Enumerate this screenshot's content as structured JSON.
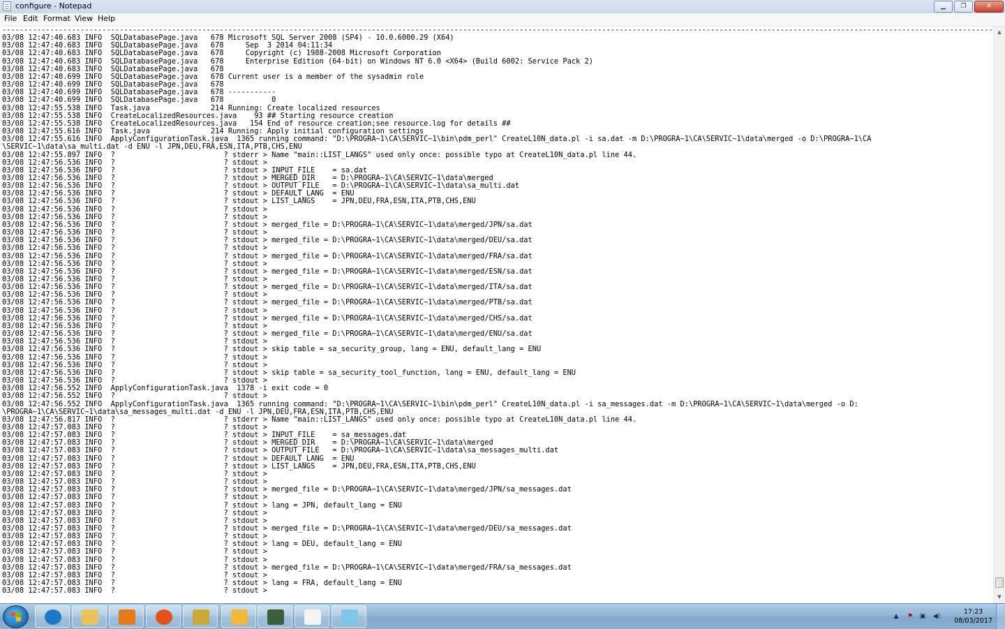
{
  "window": {
    "title": "configure - Notepad"
  },
  "menu": [
    "File",
    "Edit",
    "Format",
    "View",
    "Help"
  ],
  "log_lines": [
    "---------------------------------------------------------------------------------------------------------------------------------------------------------------------------------------------------------------------------------------------------------------",
    "03/08 12:47:40.683 INFO  SQLDatabasePage.java   678 Microsoft SQL Server 2008 (SP4) - 10.0.6000.29 (X64)",
    "03/08 12:47:40.683 INFO  SQLDatabasePage.java   678     Sep  3 2014 04:11:34",
    "03/08 12:47:40.683 INFO  SQLDatabasePage.java   678     Copyright (c) 1988-2008 Microsoft Corporation",
    "03/08 12:47:40.683 INFO  SQLDatabasePage.java   678     Enterprise Edition (64-bit) on Windows NT 6.0 <X64> (Build 6002: Service Pack 2)",
    "03/08 12:47:40.683 INFO  SQLDatabasePage.java   678",
    "03/08 12:47:40.699 INFO  SQLDatabasePage.java   678 Current user is a member of the sysadmin role",
    "03/08 12:47:40.699 INFO  SQLDatabasePage.java   678",
    "03/08 12:47:40.699 INFO  SQLDatabasePage.java   678 -----------",
    "03/08 12:47:40.699 INFO  SQLDatabasePage.java   678           0",
    "03/08 12:47:55.538 INFO  Task.java              214 Running: Create localized resources",
    "03/08 12:47:55.538 INFO  CreateLocalizedResources.java    93 ## Starting resource creation",
    "03/08 12:47:55.538 INFO  CreateLocalizedResources.java   154 End of resource creation;see resource.log for details ##",
    "03/08 12:47:55.616 INFO  Task.java              214 Running: Apply initial configuration settings",
    "03/08 12:47:55.616 INFO  ApplyConfigurationTask.java  1365 running command: \"D:\\PROGRA~1\\CA\\SERVIC~1\\bin\\pdm_perl\" CreateL10N_data.pl -i sa.dat -m D:\\PROGRA~1\\CA\\SERVIC~1\\data\\merged -o D:\\PROGRA~1\\CA",
    "\\SERVIC~1\\data\\sa_multi.dat -d ENU -l JPN,DEU,FRA,ESN,ITA,PTB,CHS,ENU",
    "03/08 12:47:55.897 INFO  ?                         ? stderr > Name \"main::LIST_LANGS\" used only once: possible typo at CreateL10N_data.pl line 44.",
    "03/08 12:47:56.536 INFO  ?                         ? stdout >",
    "03/08 12:47:56.536 INFO  ?                         ? stdout > INPUT_FILE    = sa.dat",
    "03/08 12:47:56.536 INFO  ?                         ? stdout > MERGED_DIR    = D:\\PROGRA~1\\CA\\SERVIC~1\\data\\merged",
    "03/08 12:47:56.536 INFO  ?                         ? stdout > OUTPUT_FILE   = D:\\PROGRA~1\\CA\\SERVIC~1\\data\\sa_multi.dat",
    "03/08 12:47:56.536 INFO  ?                         ? stdout > DEFAULT_LANG  = ENU",
    "03/08 12:47:56.536 INFO  ?                         ? stdout > LIST_LANGS    = JPN,DEU,FRA,ESN,ITA,PTB,CHS,ENU",
    "03/08 12:47:56.536 INFO  ?                         ? stdout >",
    "03/08 12:47:56.536 INFO  ?                         ? stdout >",
    "03/08 12:47:56.536 INFO  ?                         ? stdout > merged_file = D:\\PROGRA~1\\CA\\SERVIC~1\\data\\merged/JPN/sa.dat",
    "03/08 12:47:56.536 INFO  ?                         ? stdout >",
    "03/08 12:47:56.536 INFO  ?                         ? stdout > merged_file = D:\\PROGRA~1\\CA\\SERVIC~1\\data\\merged/DEU/sa.dat",
    "03/08 12:47:56.536 INFO  ?                         ? stdout >",
    "03/08 12:47:56.536 INFO  ?                         ? stdout > merged_file = D:\\PROGRA~1\\CA\\SERVIC~1\\data\\merged/FRA/sa.dat",
    "03/08 12:47:56.536 INFO  ?                         ? stdout >",
    "03/08 12:47:56.536 INFO  ?                         ? stdout > merged_file = D:\\PROGRA~1\\CA\\SERVIC~1\\data\\merged/ESN/sa.dat",
    "03/08 12:47:56.536 INFO  ?                         ? stdout >",
    "03/08 12:47:56.536 INFO  ?                         ? stdout > merged_file = D:\\PROGRA~1\\CA\\SERVIC~1\\data\\merged/ITA/sa.dat",
    "03/08 12:47:56.536 INFO  ?                         ? stdout >",
    "03/08 12:47:56.536 INFO  ?                         ? stdout > merged_file = D:\\PROGRA~1\\CA\\SERVIC~1\\data\\merged/PTB/sa.dat",
    "03/08 12:47:56.536 INFO  ?                         ? stdout >",
    "03/08 12:47:56.536 INFO  ?                         ? stdout > merged_file = D:\\PROGRA~1\\CA\\SERVIC~1\\data\\merged/CHS/sa.dat",
    "03/08 12:47:56.536 INFO  ?                         ? stdout >",
    "03/08 12:47:56.536 INFO  ?                         ? stdout > merged_file = D:\\PROGRA~1\\CA\\SERVIC~1\\data\\merged/ENU/sa.dat",
    "03/08 12:47:56.536 INFO  ?                         ? stdout >",
    "03/08 12:47:56.536 INFO  ?                         ? stdout > skip table = sa_security_group, lang = ENU, default_lang = ENU",
    "03/08 12:47:56.536 INFO  ?                         ? stdout >",
    "03/08 12:47:56.536 INFO  ?                         ? stdout >",
    "03/08 12:47:56.536 INFO  ?                         ? stdout > skip table = sa_security_tool_function, lang = ENU, default_lang = ENU",
    "03/08 12:47:56.536 INFO  ?                         ? stdout >",
    "03/08 12:47:56.552 INFO  ApplyConfigurationTask.java  1378 -i exit code = 0",
    "03/08 12:47:56.552 INFO  ?                         ? stdout >",
    "03/08 12:47:56.552 INFO  ApplyConfigurationTask.java  1365 running command: \"D:\\PROGRA~1\\CA\\SERVIC~1\\bin\\pdm_perl\" CreateL10N_data.pl -i sa_messages.dat -m D:\\PROGRA~1\\CA\\SERVIC~1\\data\\merged -o D:",
    "\\PROGRA~1\\CA\\SERVIC~1\\data\\sa_messages_multi.dat -d ENU -l JPN,DEU,FRA,ESN,ITA,PTB,CHS,ENU",
    "03/08 12:47:56.817 INFO  ?                         ? stderr > Name \"main::LIST_LANGS\" used only once: possible typo at CreateL10N_data.pl line 44.",
    "03/08 12:47:57.083 INFO  ?                         ? stdout >",
    "03/08 12:47:57.083 INFO  ?                         ? stdout > INPUT_FILE    = sa_messages.dat",
    "03/08 12:47:57.083 INFO  ?                         ? stdout > MERGED_DIR    = D:\\PROGRA~1\\CA\\SERVIC~1\\data\\merged",
    "03/08 12:47:57.083 INFO  ?                         ? stdout > OUTPUT_FILE   = D:\\PROGRA~1\\CA\\SERVIC~1\\data\\sa_messages_multi.dat",
    "03/08 12:47:57.083 INFO  ?                         ? stdout > DEFAULT_LANG  = ENU",
    "03/08 12:47:57.083 INFO  ?                         ? stdout > LIST_LANGS    = JPN,DEU,FRA,ESN,ITA,PTB,CHS,ENU",
    "03/08 12:47:57.083 INFO  ?                         ? stdout >",
    "03/08 12:47:57.083 INFO  ?                         ? stdout >",
    "03/08 12:47:57.083 INFO  ?                         ? stdout > merged_file = D:\\PROGRA~1\\CA\\SERVIC~1\\data\\merged/JPN/sa_messages.dat",
    "03/08 12:47:57.083 INFO  ?                         ? stdout >",
    "03/08 12:47:57.083 INFO  ?                         ? stdout > lang = JPN, default_lang = ENU",
    "03/08 12:47:57.083 INFO  ?                         ? stdout >",
    "03/08 12:47:57.083 INFO  ?                         ? stdout >",
    "03/08 12:47:57.083 INFO  ?                         ? stdout > merged_file = D:\\PROGRA~1\\CA\\SERVIC~1\\data\\merged/DEU/sa_messages.dat",
    "03/08 12:47:57.083 INFO  ?                         ? stdout >",
    "03/08 12:47:57.083 INFO  ?                         ? stdout > lang = DEU, default_lang = ENU",
    "03/08 12:47:57.083 INFO  ?                         ? stdout >",
    "03/08 12:47:57.083 INFO  ?                         ? stdout >",
    "03/08 12:47:57.083 INFO  ?                         ? stdout > merged_file = D:\\PROGRA~1\\CA\\SERVIC~1\\data\\merged/FRA/sa_messages.dat",
    "03/08 12:47:57.083 INFO  ?                         ? stdout >",
    "03/08 12:47:57.083 INFO  ?                         ? stdout > lang = FRA, default_lang = ENU",
    "03/08 12:47:57.083 INFO  ?                         ? stdout >"
  ],
  "taskbar": {
    "apps": [
      {
        "icon": "internet-explorer-icon",
        "color": "#1e78c8"
      },
      {
        "icon": "file-explorer-icon",
        "color": "#e8c25a"
      },
      {
        "icon": "media-player-icon",
        "color": "#e67a1f"
      },
      {
        "icon": "firefox-icon",
        "color": "#e2531b"
      },
      {
        "icon": "folder-icon",
        "color": "#c9a93c"
      },
      {
        "icon": "outlook-icon",
        "color": "#f0b93a"
      },
      {
        "icon": "terminal-icon",
        "color": "#3b5f3b"
      },
      {
        "icon": "notepad-icon",
        "color": "#f4f4f4"
      },
      {
        "icon": "generic-app-icon",
        "color": "#7fc6e8"
      }
    ],
    "clock_time": "17:23",
    "clock_date": "08/03/2017"
  }
}
